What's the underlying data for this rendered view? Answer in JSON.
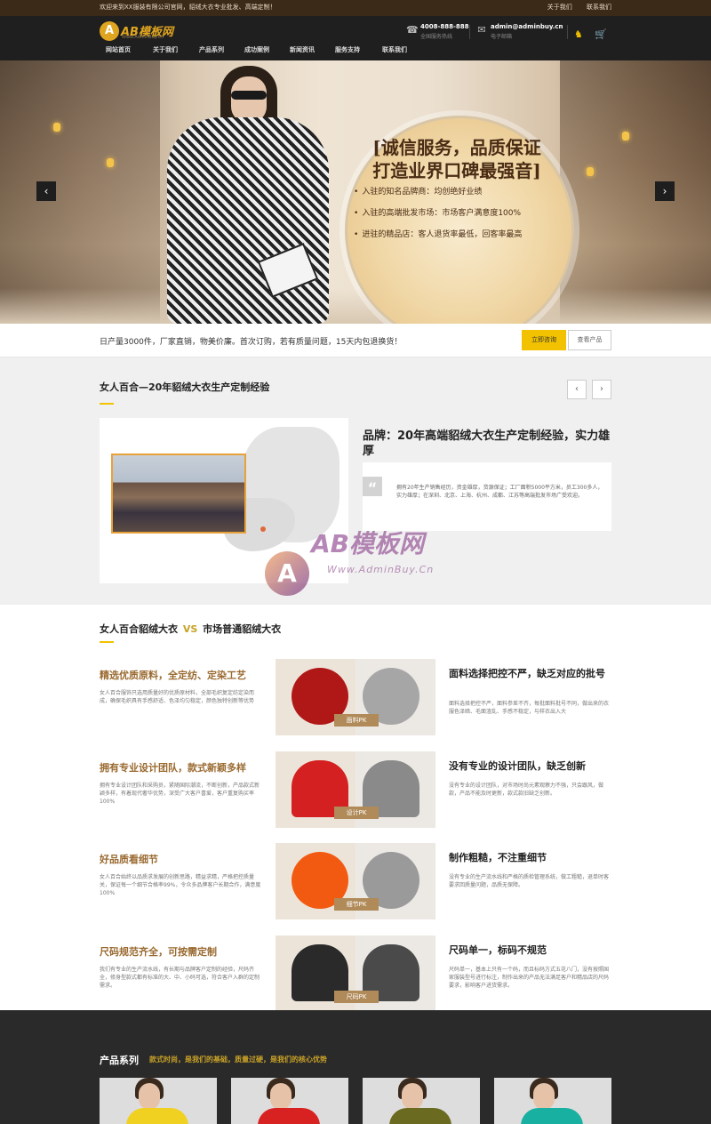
{
  "topbar": {
    "welcome": "欢迎来到XX服装有限公司官网，貂绒大衣专业批发、高端定制！",
    "links": [
      "关于我们",
      "联系我们"
    ]
  },
  "header": {
    "logo_mark": "A",
    "logo_name": "AB模板网",
    "logo_sub": "Www.AdminBuy.Cn",
    "phone": "4008-888-888",
    "phone_label": "全国服务热线",
    "email": "admin@adminbuy.cn",
    "email_label": "电子邮箱",
    "icons": [
      "qq-icon",
      "cart-icon"
    ],
    "accent": "#f2c200"
  },
  "nav": [
    "网站首页",
    "关于我们",
    "产品系列",
    "成功案例",
    "新闻资讯",
    "服务支持",
    "联系我们"
  ],
  "banner": {
    "slogan_line1": "[诚信服务，品质保证",
    "slogan_line2": "打造业界口碑最强音]",
    "bullets": [
      "入驻的知名品牌商：均创绝好业绩",
      "入驻的高端批发市场：市场客户满意度100%",
      "进驻的精品店：客人退货率最低，回客率最高"
    ],
    "prev": "‹",
    "next": "›"
  },
  "strip": {
    "text": "日产量3000件，厂家直销，物美价廉。首次订购，若有质量问题，15天内包退换货！",
    "btn_primary": "立即咨询",
    "btn_secondary": "查看产品"
  },
  "brand": {
    "title": "女人百合—20年貂绒大衣生产定制经验",
    "prev": "‹",
    "next": "›",
    "heading": "品牌：20年高端貂绒大衣生产定制经验，实力雄厚",
    "quote_mark": "“",
    "body": "拥有20年生产销售经历，资金雄厚，货源保证；工厂面积5000平方米，员工300多人，实力雄厚；在深圳、北京、上海、杭州、成都、江苏等高端批发市场广受欢迎。"
  },
  "watermark": {
    "mark": "A",
    "name": "AB模板网",
    "url": "Www.AdminBuy.Cn"
  },
  "compare": {
    "title_left": "女人百合貂绒大衣",
    "vs": "VS",
    "title_right": "市场普通貂绒大衣",
    "rows": [
      {
        "left_title": "精选优质原料，全定纺、定染工艺",
        "left_desc": "女人百合服饰只选用质量好的优质原材料，全部毛织复定纺定染而成，确保毛织具有手感舒适、色泽均匀稳定，颜色独特创新等优势",
        "tag": "面料PK",
        "swatch_left": "#b01818",
        "swatch_right": "#a6a6a6",
        "right_title": "面料选择把控不严，缺乏对应的批号",
        "right_desc": "面料选择把控不严，面料参差不齐，每批面料批号不同，做出来的衣服色泽暗、毛面渣乱、手感不稳定，与样衣出入大"
      },
      {
        "left_title": "拥有专业设计团队，款式新颖多样",
        "left_desc": "拥有专业设计团队和采购员，紧随国际潮流，不断创新，产品款式新颖多样，有着现代奢华优势，深受广大客户喜爱，客户重复购买率100%",
        "tag": "设计PK",
        "swatch_left": "#d42020",
        "swatch_right": "#8a8a8a",
        "right_title": "没有专业的设计团队，缺乏创新",
        "right_desc": "没有专业的设计团队，对市场时尚元素观察力不强，只会跟风，做款，产品不能及时更新，款式款旧缺乏创新。"
      },
      {
        "left_title": "好品质看细节",
        "left_desc": "女人百合始终以品质求发展的创新思路，精益求精，严格把控质量关，保证每一个细节合格率99%，令众多品牌客户长期合作，满意度100%",
        "tag": "细节PK",
        "swatch_left": "#f25a12",
        "swatch_right": "#9a9a9a",
        "right_title": "制作粗糙，不注重细节",
        "right_desc": "没有专业的生产流水线和严格的质检管理系统，做工粗糙，退单时客要求回质量问题，品质无保障。"
      },
      {
        "left_title": "尺码规范齐全，可按需定制",
        "left_desc": "我们有专业的生产流水线，有长期与品牌客户定制的经验，尺码齐全，修身型款式都有标准的大、中、小码可选，符合客户入群的定制需求。",
        "tag": "尺码PK",
        "swatch_left": "#2a2a2a",
        "swatch_right": "#4a4a4a",
        "right_title": "尺码单一，标码不规范",
        "right_desc": "尺码单一，基本上只有一个码，而且标码方式五花八门，没有按照国家服装型号进行标注，制作出来的产品无法满足客户和精品店的尺码要求，影响客户进货需求。"
      }
    ]
  },
  "products": {
    "title": "产品系列",
    "subtitle": "款式时尚，是我们的基础，质量过硬，是我们的核心优势",
    "items": [
      {
        "accent": "#f0d020"
      },
      {
        "accent": "#d82222"
      },
      {
        "accent": "#6a6a20"
      },
      {
        "accent": "#18b0a0"
      }
    ]
  }
}
